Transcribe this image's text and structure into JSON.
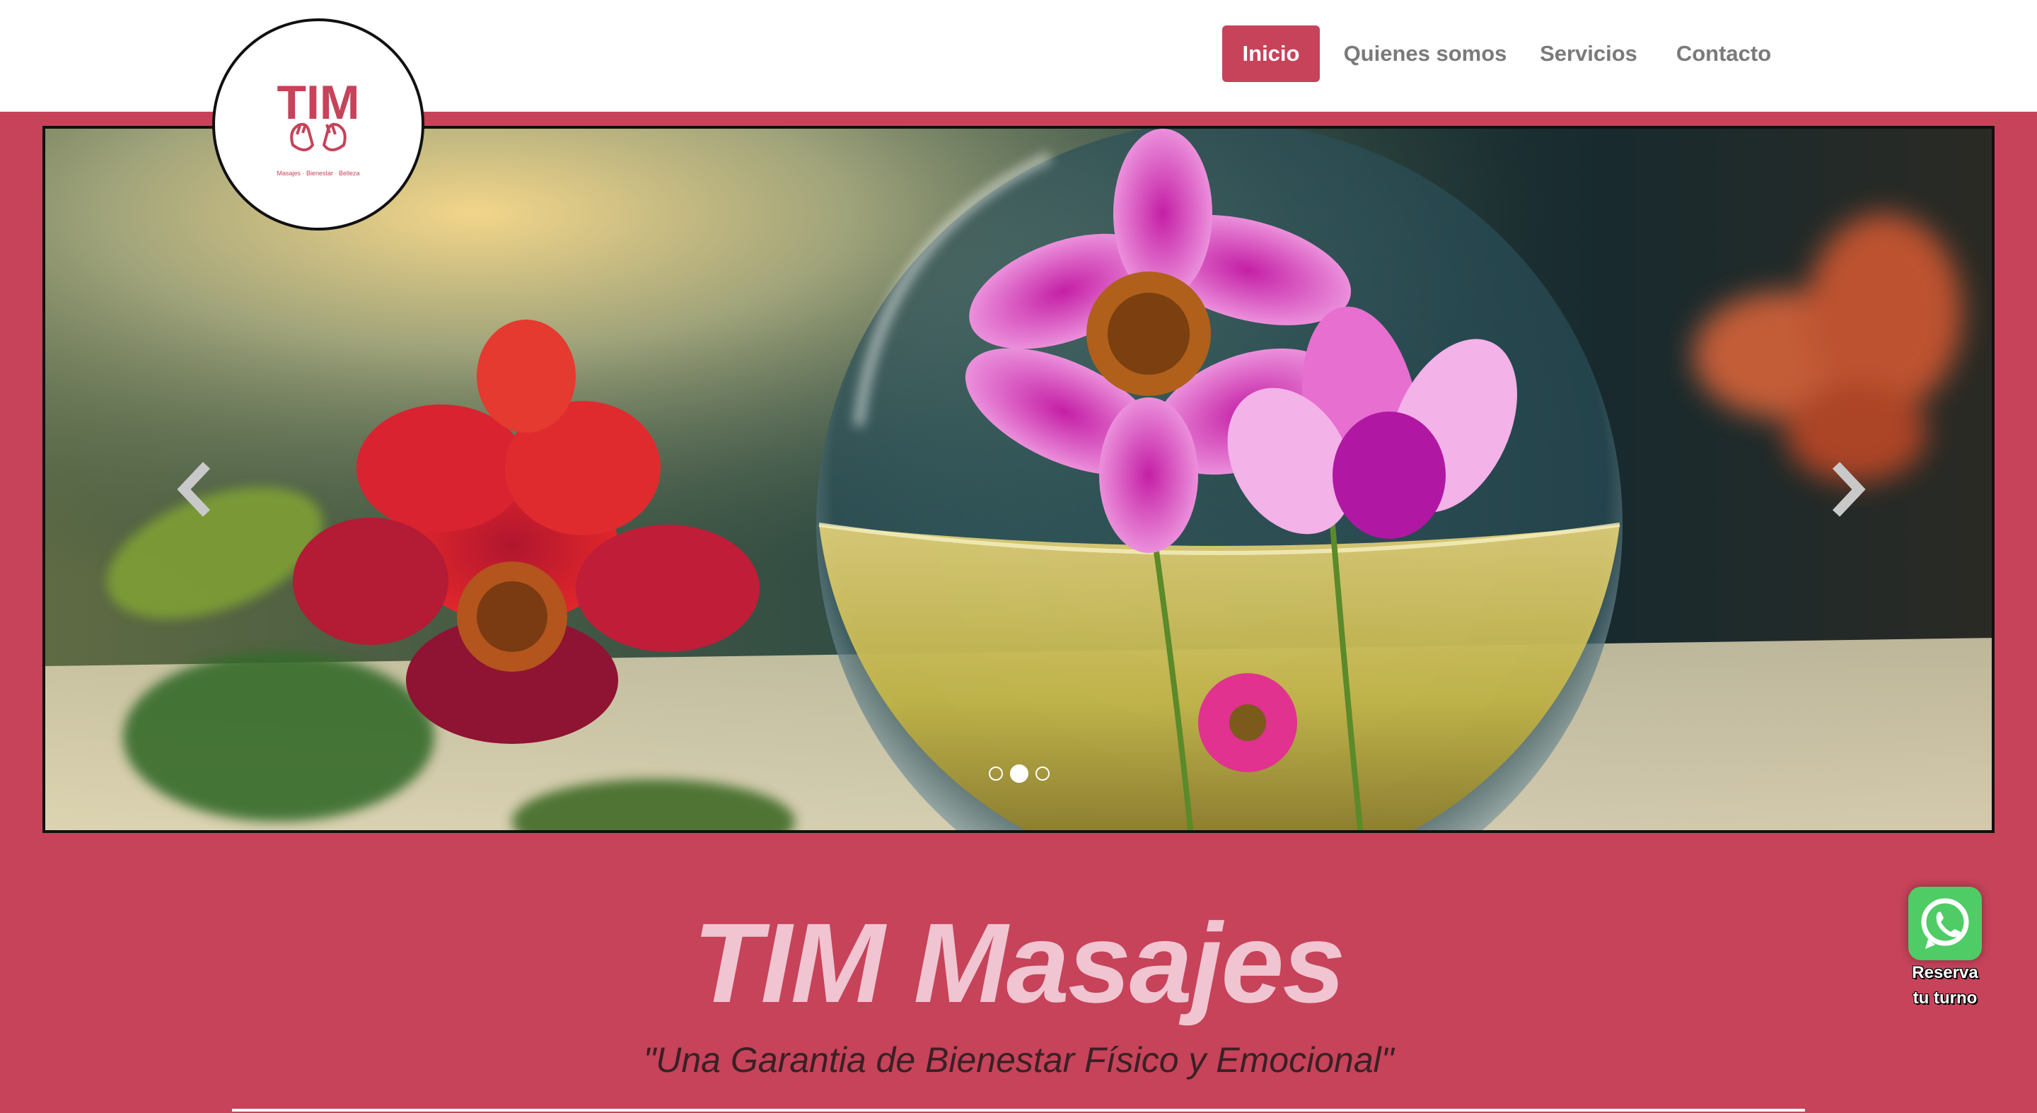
{
  "brand": {
    "logo_text": "TIM",
    "logo_tagline": "Masajes · Bienestar · Belleza"
  },
  "nav": {
    "items": [
      {
        "label": "Inicio",
        "active": true
      },
      {
        "label": "Quienes somos",
        "active": false
      },
      {
        "label": "Servicios",
        "active": false
      },
      {
        "label": "Contacto",
        "active": false
      }
    ]
  },
  "carousel": {
    "slides_count": 3,
    "active_slide": 2,
    "prev_icon": "chevron-left-icon",
    "next_icon": "chevron-right-icon"
  },
  "hero": {
    "title": "TIM Masajes",
    "subtitle": "\"Una Garantia de Bienestar Físico y Emocional\""
  },
  "whatsapp": {
    "icon": "whatsapp-icon",
    "label_line1": "Reserva",
    "label_line2": "tu turno"
  },
  "colors": {
    "brand": "#c6435a",
    "title": "#f0c4d1",
    "nav_text": "#7a7a7a",
    "whatsapp": "#4fcc66"
  }
}
